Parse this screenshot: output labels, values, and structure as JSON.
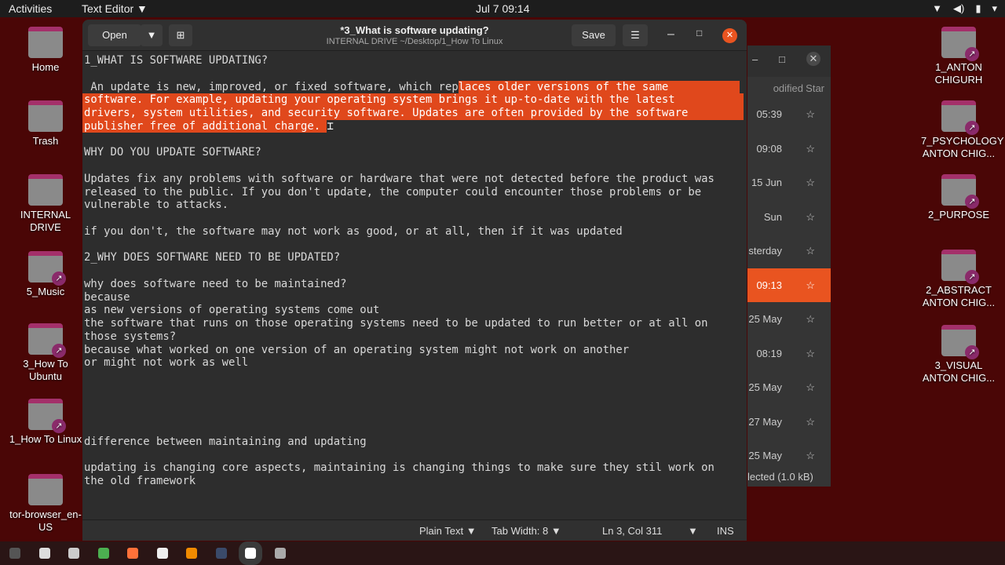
{
  "topbar": {
    "activities": "Activities",
    "app_menu": "Text Editor ▼",
    "clock": "Jul 7  09:14"
  },
  "desktop_left": [
    "Home",
    "Trash",
    "INTERNAL DRIVE",
    "5_Music",
    "3_How To Ubuntu",
    "1_How To Linux",
    "tor-browser_en-US"
  ],
  "desktop_right": [
    "1_ANTON CHIGURH",
    "7_PSYCHOLOGY ANTON CHIG...",
    "2_PURPOSE",
    "2_ABSTRACT ANTON CHIG...",
    "3_VISUAL ANTON CHIG..."
  ],
  "file_manager": {
    "header_modified": "odified",
    "header_star": "Star",
    "rows": [
      "05:39",
      "09:08",
      "15 Jun",
      "Sun",
      "sterday",
      "09:13",
      "25 May",
      "08:19",
      "25 May",
      "27 May",
      "25 May"
    ],
    "selected_index": 5,
    "footer": "lected (1.0 kB)"
  },
  "editor": {
    "open_label": "Open",
    "save_label": "Save",
    "title": "*3_What is software updating?",
    "subtitle": "INTERNAL DRIVE ~/Desktop/1_How To Linux",
    "lines": [
      "1_WHAT IS SOFTWARE UPDATING?",
      "",
      {
        "pre": " An update is new, improved, or fixed software, which rep",
        "sel": "laces older versions of the same"
      },
      {
        "sel": "software. For example, updating your operating system brings it up-to-date with the latest"
      },
      {
        "sel": "drivers, system utilities, and security software. Updates are often provided by the software"
      },
      {
        "selpart": "publisher free of additional charge. "
      },
      "",
      "WHY DO YOU UPDATE SOFTWARE?",
      "",
      "Updates fix any problems with software or hardware that were not detected before the product was",
      "released to the public. If you don't update, the computer could encounter those problems or be",
      "vulnerable to attacks.",
      "",
      "if you don't, the software may not work as good, or at all, then if it was updated",
      "",
      "2_WHY DOES SOFTWARE NEED TO BE UPDATED?",
      "",
      "why does software need to be maintained?",
      "because",
      "as new versions of operating systems come out",
      "the software that runs on those operating systems need to be updated to run better or at all on",
      "those systems?",
      "because what worked on one version of an operating system might not work on another",
      "or might not work as well",
      "",
      "",
      "",
      "",
      "",
      "difference between maintaining and updating",
      "",
      "updating is changing core aspects, maintaining is changing things to make sure they stil work on",
      "the old framework"
    ],
    "status": {
      "language": "Plain Text ▼",
      "tab_width": "Tab Width: 8 ▼",
      "position": "Ln 3, Col 311",
      "mode": "INS"
    }
  },
  "colors": {
    "accent": "#e95420",
    "desktop": "#4a0606"
  }
}
